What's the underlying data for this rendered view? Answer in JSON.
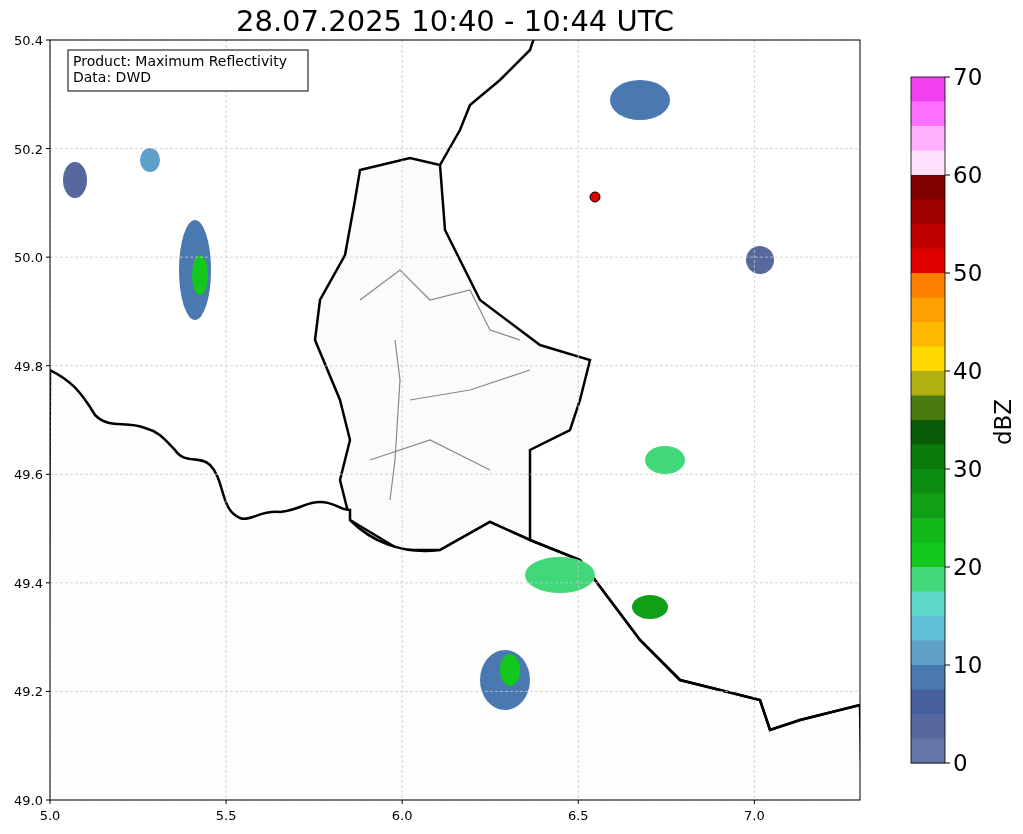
{
  "title": "28.07.2025 10:40 - 10:44 UTC",
  "legend": [
    "Product: Maximum Reflectivity",
    "Data: DWD"
  ],
  "x_axis": {
    "ticks": [
      "5.0",
      "5.5",
      "6.0",
      "6.5",
      "7.0"
    ]
  },
  "y_axis": {
    "ticks": [
      "50.4",
      "50.2",
      "50.0",
      "49.8",
      "49.6",
      "49.4",
      "49.2",
      "49.0"
    ]
  },
  "colorbar": {
    "label": "dBZ",
    "ticks": [
      "70",
      "60",
      "50",
      "40",
      "30",
      "20",
      "10",
      "0"
    ],
    "segments": [
      {
        "color": "#f040f0"
      },
      {
        "color": "#ff70ff"
      },
      {
        "color": "#ffb0ff"
      },
      {
        "color": "#ffe0ff"
      },
      {
        "color": "#800000"
      },
      {
        "color": "#a00000"
      },
      {
        "color": "#c00000"
      },
      {
        "color": "#e00000"
      },
      {
        "color": "#ff8000"
      },
      {
        "color": "#ffa000"
      },
      {
        "color": "#ffb800"
      },
      {
        "color": "#ffd800"
      },
      {
        "color": "#b0b010"
      },
      {
        "color": "#4a7a10"
      },
      {
        "color": "#085c08"
      },
      {
        "color": "#0a7a0a"
      },
      {
        "color": "#0c8c10"
      },
      {
        "color": "#10a018"
      },
      {
        "color": "#10b818"
      },
      {
        "color": "#12c81e"
      },
      {
        "color": "#40d878"
      },
      {
        "color": "#60d8c8"
      },
      {
        "color": "#60c0d8"
      },
      {
        "color": "#5ea0c8"
      },
      {
        "color": "#4a78b0"
      },
      {
        "color": "#4660a0"
      },
      {
        "color": "#56689e"
      },
      {
        "color": "#6577a8"
      }
    ]
  }
}
